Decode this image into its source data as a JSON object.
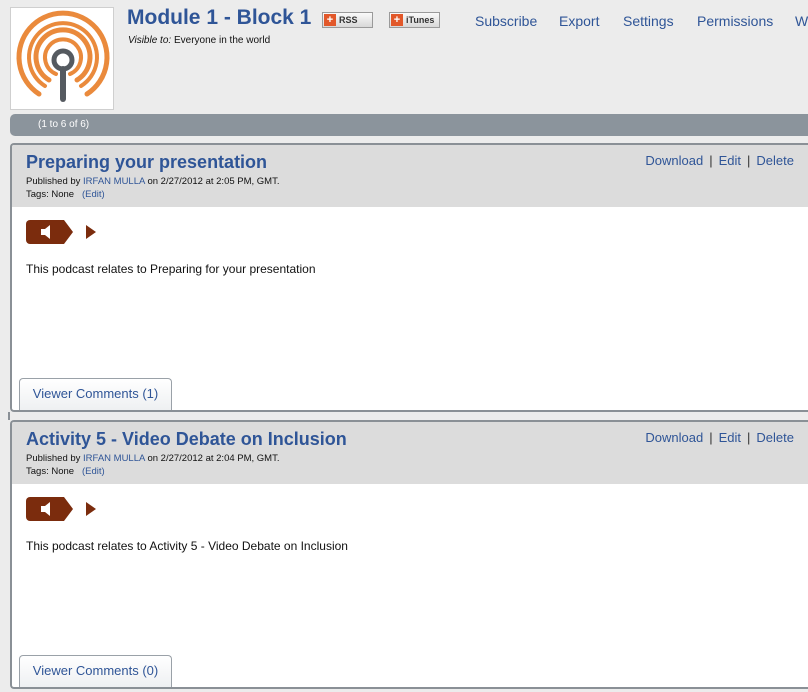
{
  "header": {
    "title": "Module 1 - Block 1",
    "rss_label": "RSS",
    "itunes_label": "iTunes",
    "visible_label": "Visible to:",
    "visible_value": "Everyone in the world",
    "nav": [
      "Subscribe",
      "Export",
      "Settings",
      "Permissions",
      "W"
    ]
  },
  "pager": {
    "text": "(1 to 6 of 6)"
  },
  "episodes": [
    {
      "title": "Preparing your presentation",
      "published_prefix": "Published by",
      "author": "IRFAN MULLA",
      "published_suffix": "on 2/27/2012 at 2:05 PM, GMT.",
      "tags_label": "Tags: None",
      "tags_edit": "(Edit)",
      "actions": [
        "Download",
        "Edit",
        "Delete"
      ],
      "description": "This podcast relates to Preparing for your presentation",
      "comments_label": "Viewer Comments (1)"
    },
    {
      "title": "Activity 5 - Video Debate on Inclusion",
      "published_prefix": "Published by",
      "author": "IRFAN MULLA",
      "published_suffix": "on 2/27/2012 at 2:04 PM, GMT.",
      "tags_label": "Tags: None",
      "tags_edit": "(Edit)",
      "actions": [
        "Download",
        "Edit",
        "Delete"
      ],
      "description": "This podcast relates to Activity 5 - Video Debate on Inclusion",
      "comments_label": "Viewer Comments (0)"
    }
  ],
  "colors": {
    "link": "#2f5597",
    "player": "#7b2c0d",
    "logo_orange": "#ea8a3c",
    "logo_gray": "#555a60"
  },
  "icons": {
    "logo": "podcast-logo",
    "speaker": "speaker-icon",
    "play": "play-icon"
  }
}
